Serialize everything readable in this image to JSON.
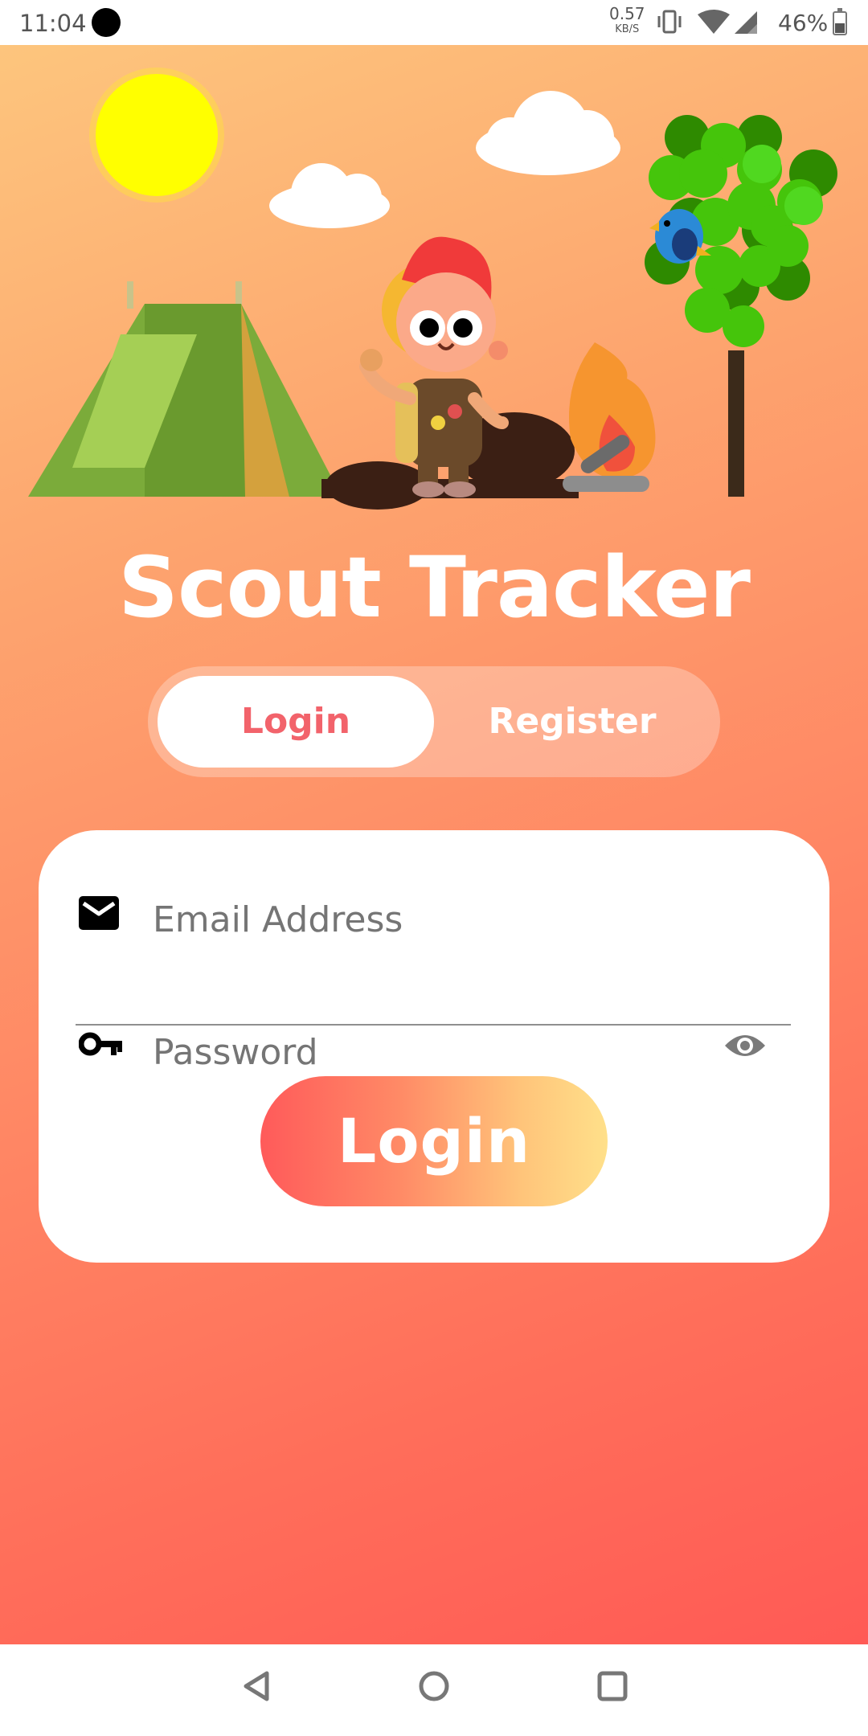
{
  "status_bar": {
    "time": "11:04",
    "net_speed": "0.57",
    "net_speed_unit": "KB/S",
    "battery": "46%"
  },
  "illustration": {
    "elements": [
      "sun",
      "cloud",
      "cloud",
      "tent",
      "scout-character",
      "campfire",
      "tree",
      "bird"
    ]
  },
  "app": {
    "title": "Scout Tracker"
  },
  "mode_toggle": {
    "login_label": "Login",
    "register_label": "Register",
    "selected": "Login"
  },
  "form": {
    "email_placeholder": "Email Address",
    "email_value": "",
    "password_placeholder": "Password",
    "password_value": "",
    "submit_label": "Login"
  },
  "icons": {
    "email": "mail-icon",
    "password": "key-icon",
    "toggle_visibility": "eye-icon"
  },
  "colors": {
    "accent": "#f2636b",
    "gradient_top": "#fdc57d",
    "gradient_bottom": "#ff5a55"
  },
  "nav_bar": {
    "buttons": [
      "back",
      "home",
      "recents"
    ]
  }
}
